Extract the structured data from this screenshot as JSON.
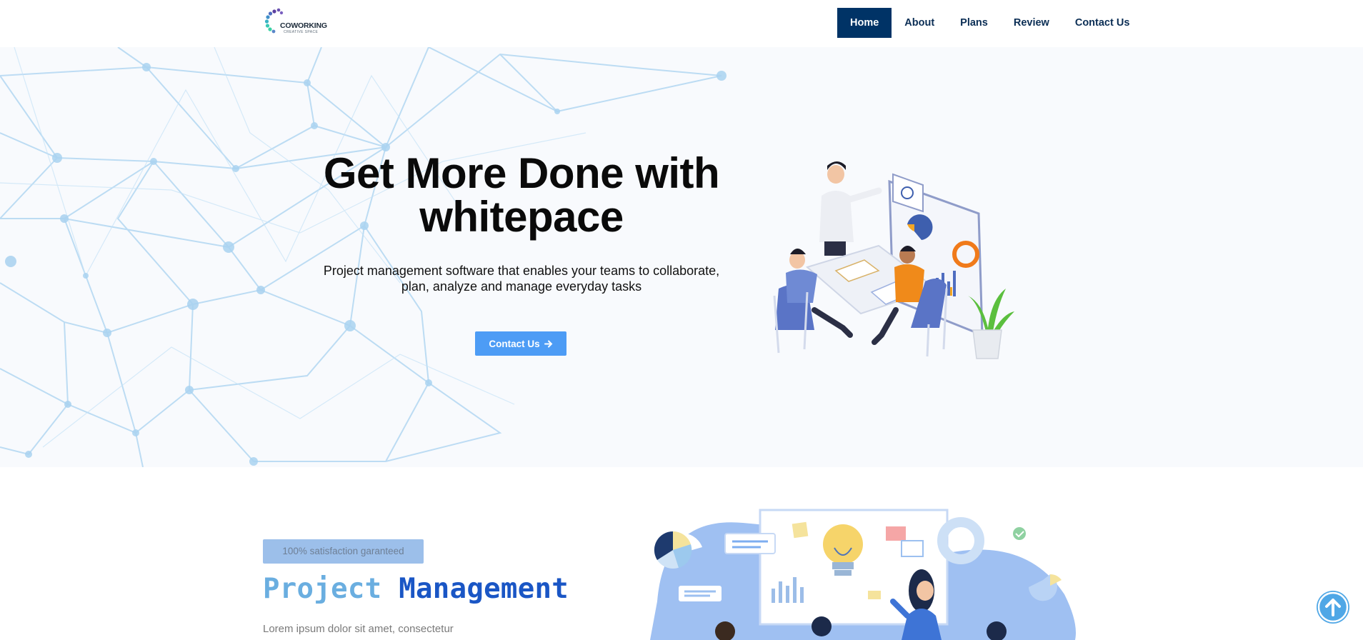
{
  "brand": {
    "name": "COWORKING",
    "tagline": "CREATIVE SPACE",
    "logo_icon": "dots-ring-icon",
    "colors": {
      "teal": "#39c9b5",
      "purple": "#5b3fa0",
      "navy": "#003366",
      "accent": "#4d9cf5"
    }
  },
  "nav": {
    "items": [
      {
        "label": "Home",
        "active": true
      },
      {
        "label": "About",
        "active": false
      },
      {
        "label": "Plans",
        "active": false
      },
      {
        "label": "Review",
        "active": false
      },
      {
        "label": "Contact Us",
        "active": false
      }
    ]
  },
  "hero": {
    "title_line1": "Get More Done with",
    "title_line2": "whitepace",
    "subtitle_line1": "Project management software that enables your teams to collaborate,",
    "subtitle_line2": "plan, analyze and manage everyday tasks",
    "cta_label": "Contact Us",
    "cta_icon": "arrow-right-icon"
  },
  "feature": {
    "badge": "100% satisfaction garanteed",
    "title_word1": "Project",
    "title_word2": "Management",
    "text": "Lorem ipsum dolor sit amet, consectetur"
  },
  "scroll_top": {
    "icon": "arrow-up-circle-icon"
  }
}
